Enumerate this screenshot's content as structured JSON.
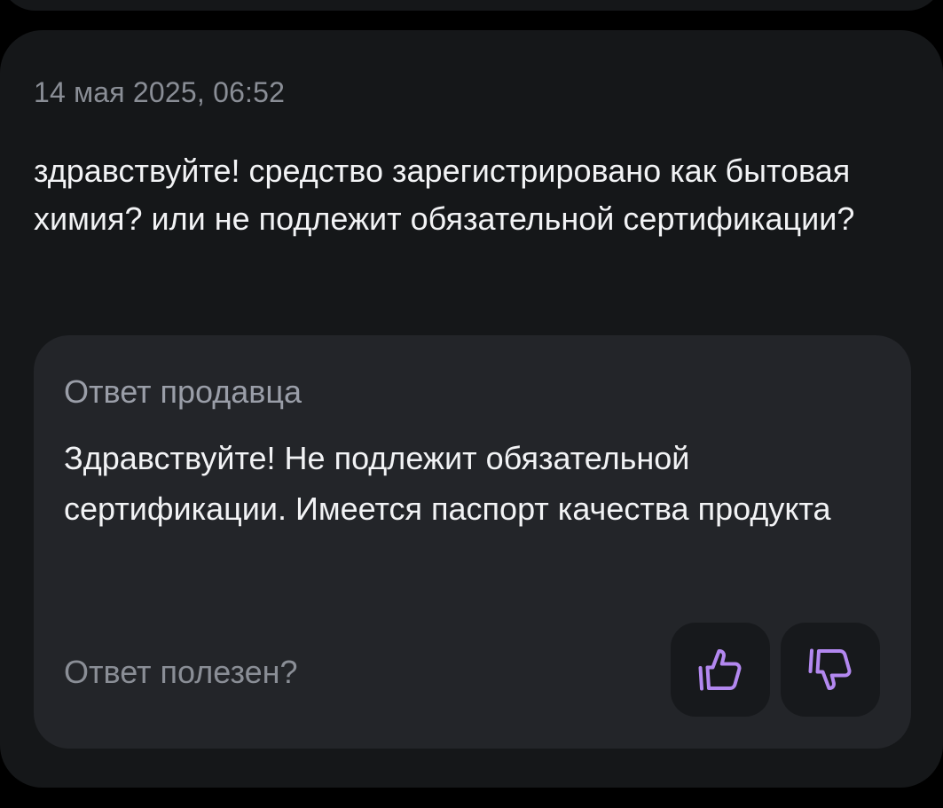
{
  "question": {
    "date": "14 мая 2025, 06:52",
    "text": "здравствуйте! средство зарегистрировано как бытовая химия? или не подлежит обязательной сертификации?"
  },
  "seller_answer": {
    "title": "Ответ продавца",
    "text": "Здравствуйте! Не подлежит обязательной сертификации. Имеется паспорт качества продукта"
  },
  "feedback": {
    "prompt": "Ответ полезен?",
    "like_icon": "thumbs-up-icon",
    "dislike_icon": "thumbs-down-icon"
  },
  "colors": {
    "background": "#000000",
    "card": "#151719",
    "answer_box": "#232529",
    "accent": "#b388f0",
    "primary_text": "#f2f3f5",
    "secondary_text": "#8a8e96"
  }
}
